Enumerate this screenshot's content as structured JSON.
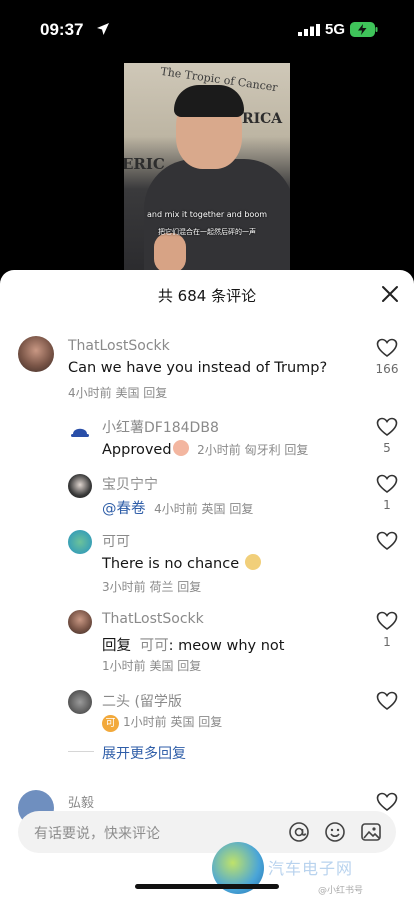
{
  "status_bar": {
    "time": "09:37",
    "network": "5G"
  },
  "video": {
    "map_text_1": "The Tropic of Cancer",
    "map_text_2": "FRICA",
    "map_text_3": "ERIC",
    "subtitle_en": "and mix it together and boom",
    "subtitle_zh": "把它们混合在一起然后砰的一声"
  },
  "sheet": {
    "title": "共 684 条评论"
  },
  "comments": [
    {
      "name": "ThatLostSockk",
      "text": "Can we have you instead of Trump?",
      "meta": "4小时前 美国 回复",
      "likes": "166"
    },
    {
      "name": "小红薯DF184DB8",
      "text": "Approved",
      "meta": "2小时前 匈牙利 回复",
      "likes": "5"
    },
    {
      "name": "宝贝宁宁",
      "mention": "@春卷",
      "meta": "4小时前 英国 回复",
      "likes": "1"
    },
    {
      "name": "可可",
      "text": "There is no chance",
      "meta": "3小时前 荷兰 回复",
      "likes": ""
    },
    {
      "name": "ThatLostSockk",
      "reply_prefix": "回复",
      "reply_to": "可可",
      "reply_text": ": meow why not",
      "meta": "1小时前 美国 回复",
      "likes": "1"
    },
    {
      "name": "二头 (留学版",
      "badge": "可",
      "meta": "1小时前 英国 回复",
      "likes": ""
    }
  ],
  "expand_more": "展开更多回复",
  "partial_comment_name": "弘毅",
  "input": {
    "placeholder": "有话要说，快来评论"
  },
  "watermark": {
    "text": "汽车电子网",
    "small": "@小红书号"
  },
  "colors": {
    "link": "#2f5ea8",
    "meta": "#8a8a8a",
    "badge": "#f2a93b"
  },
  "icons": [
    "location-arrow-icon",
    "signal-icon",
    "battery-icon",
    "close-icon",
    "heart-icon",
    "at-icon",
    "emoji-icon",
    "image-icon"
  ]
}
